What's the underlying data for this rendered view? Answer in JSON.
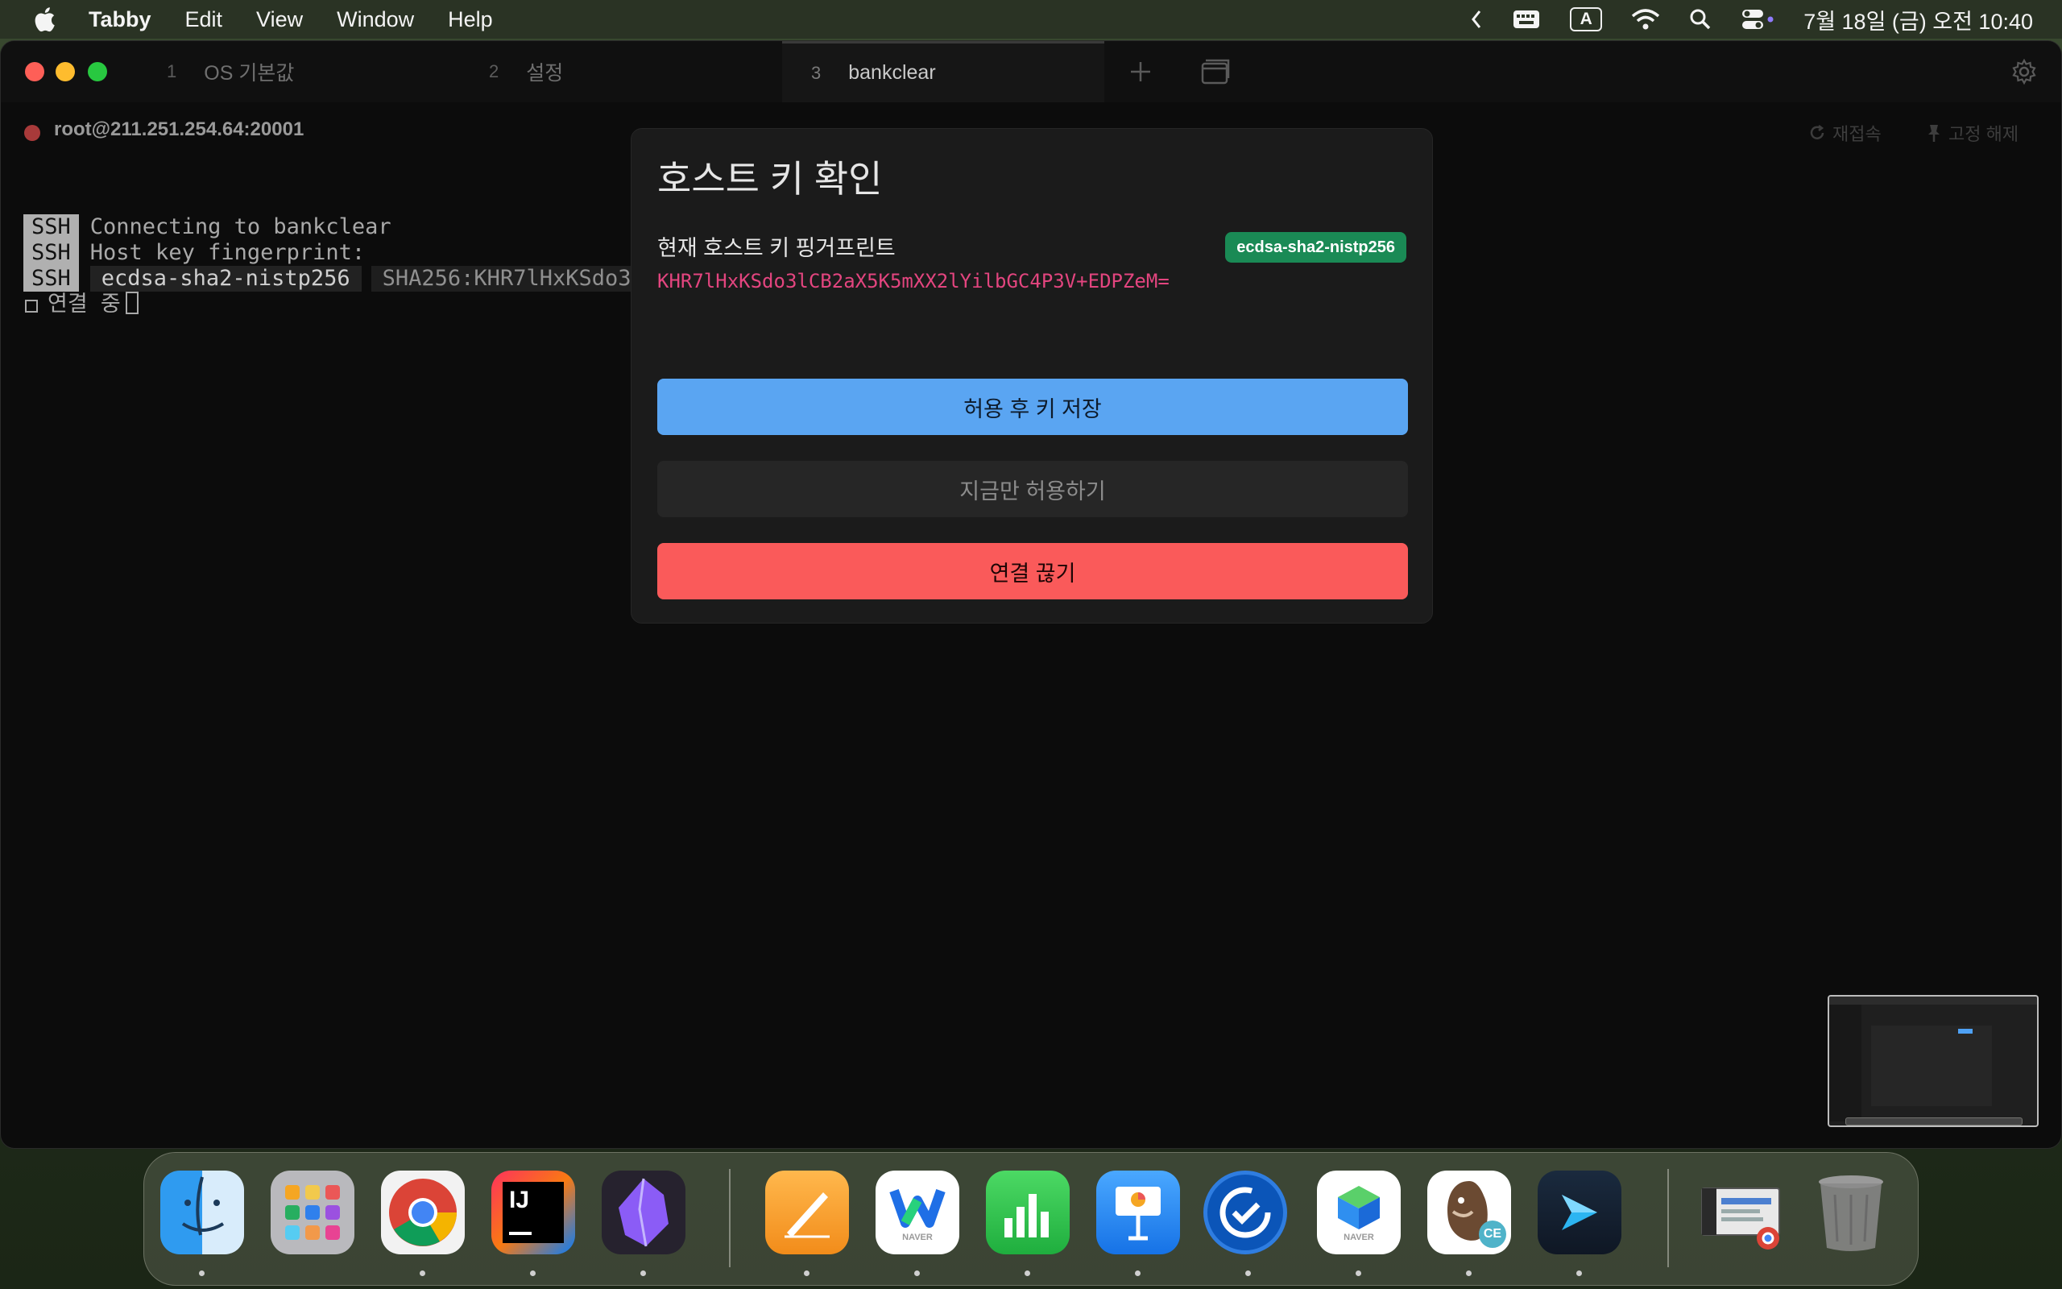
{
  "menubar": {
    "app_name": "Tabby",
    "menus": [
      "Edit",
      "View",
      "Window",
      "Help"
    ],
    "input_source": "A",
    "clock": "7월 18일 (금) 오전 10:40"
  },
  "window": {
    "tabs": [
      {
        "num": "1",
        "label": "OS 기본값"
      },
      {
        "num": "2",
        "label": "설정"
      },
      {
        "num": "3",
        "label": "bankclear"
      }
    ],
    "session": {
      "host": "root@211.251.254.64:20001",
      "reconnect_label": "재접속",
      "unpin_label": "고정 해제"
    }
  },
  "terminal": {
    "tag": "SSH",
    "line1": "Connecting to bankclear",
    "line2": "Host key fingerprint:",
    "line3_algo": "ecdsa-sha2-nistp256",
    "line3_hash": "SHA256:KHR7lHxKSdo3",
    "line4": "연결 중"
  },
  "modal": {
    "title": "호스트 키 확인",
    "fingerprint_label": "현재 호스트 키 핑거프린트",
    "algorithm": "ecdsa-sha2-nistp256",
    "fingerprint": "KHR7lHxKSdo3lCB2aX5K5mXX2lYilbGC4P3V+EDPZeM=",
    "accept_save_label": "허용 후 키 저장",
    "accept_once_label": "지금만 허용하기",
    "disconnect_label": "연결 끊기"
  },
  "dock": {
    "apps": [
      "Finder",
      "Launchpad",
      "Chrome",
      "IntelliJ IDEA",
      "Obsidian",
      "Pages",
      "Naver Whale",
      "Numbers",
      "Keynote",
      "Update",
      "Naver MYBOX",
      "DBeaver CE",
      "Tabby",
      "Window Preview",
      "Trash"
    ],
    "intellij_text": "IJ",
    "naver_text": "NAVER",
    "dbeaver_badge": "CE"
  },
  "colors": {
    "accent_blue": "#5aa5f2",
    "danger_red": "#fa5a5a",
    "badge_green": "#1a8a55",
    "fingerprint_pink": "#e3457f"
  }
}
